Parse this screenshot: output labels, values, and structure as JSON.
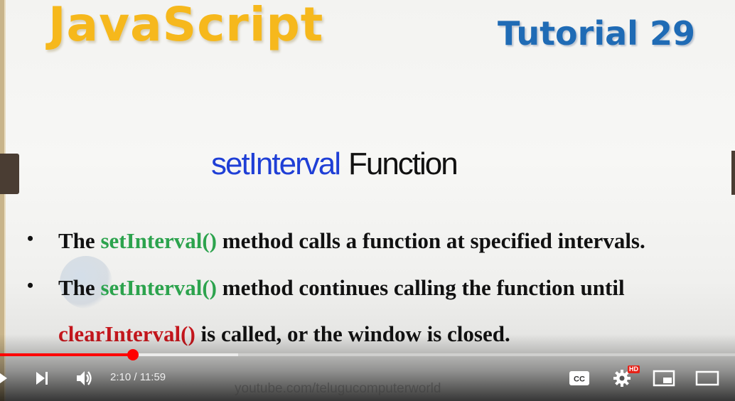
{
  "slide": {
    "title": "JavaScript",
    "tutorial": "Tutorial 29",
    "heading_keyword": "setInterval",
    "heading_rest": "Function",
    "bullet1": {
      "pre": "The ",
      "code": "setInterval()",
      "post": " method calls a function at specified intervals."
    },
    "bullet2": {
      "pre": "The ",
      "code": "setInterval()",
      "post": " method continues calling the function until"
    },
    "bullet2_cont": {
      "code": "clearInterval()",
      "post": " is called, or the window is closed."
    },
    "watermark": "youtube.com/telugucomputerworld"
  },
  "player": {
    "current_time": "2:10",
    "separator": "/",
    "duration": "11:59",
    "progress_fraction": 0.181,
    "buffered_fraction": 0.324,
    "quality_badge": "HD",
    "colors": {
      "progress": "#ff0000",
      "title": "#f6b81c",
      "tutorial": "#1f6bb5",
      "keyword": "#1f3fd6",
      "code_green": "#2ca34d",
      "code_red": "#c4161c"
    },
    "icons": [
      "play-icon",
      "next-icon",
      "volume-icon",
      "captions-icon",
      "settings-icon",
      "miniplayer-icon",
      "theater-icon"
    ]
  }
}
